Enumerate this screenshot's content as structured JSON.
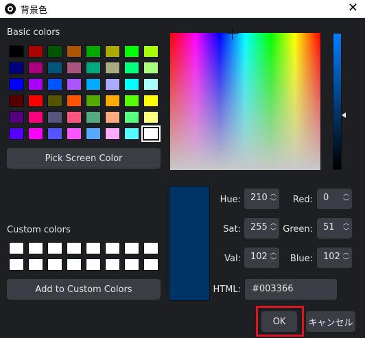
{
  "window": {
    "title": "背景色",
    "close_label": "✕"
  },
  "basic_colors": {
    "label": "Basic colors",
    "swatches": [
      "#000000",
      "#aa0000",
      "#005500",
      "#aa5500",
      "#00aa00",
      "#aaaa00",
      "#00ff00",
      "#aaff00",
      "#00007f",
      "#aa007f",
      "#00557f",
      "#aa557f",
      "#00aa7f",
      "#aaaa7f",
      "#00ff7f",
      "#aaff7f",
      "#0000ff",
      "#aa00ff",
      "#0055ff",
      "#aa55ff",
      "#00aaff",
      "#aaaaff",
      "#00ffff",
      "#aaffff",
      "#550000",
      "#ff0000",
      "#555500",
      "#ff5500",
      "#55aa00",
      "#ffaa00",
      "#55ff00",
      "#ffff00",
      "#55007f",
      "#ff007f",
      "#55557f",
      "#ff557f",
      "#55aa7f",
      "#ffaa7f",
      "#55ff7f",
      "#ffff7f",
      "#5500ff",
      "#ff00ff",
      "#5555ff",
      "#ff55ff",
      "#55aaff",
      "#ffaaff",
      "#55ffff",
      "#ffffff"
    ],
    "selected_index": 47
  },
  "pick_screen_color_label": "Pick Screen Color",
  "custom_colors": {
    "label": "Custom colors",
    "swatches": [
      "#ffffff",
      "#ffffff",
      "#ffffff",
      "#ffffff",
      "#ffffff",
      "#ffffff",
      "#ffffff",
      "#ffffff",
      "#ffffff",
      "#ffffff",
      "#ffffff",
      "#ffffff",
      "#ffffff",
      "#ffffff",
      "#ffffff",
      "#ffffff"
    ]
  },
  "add_custom_label": "Add to Custom Colors",
  "current_color": "#003366",
  "fields": {
    "hue": {
      "label": "Hue:",
      "value": "210"
    },
    "sat": {
      "label": "Sat:",
      "value": "255"
    },
    "val": {
      "label": "Val:",
      "value": "102"
    },
    "red": {
      "label": "Red:",
      "value": "0"
    },
    "green": {
      "label": "Green:",
      "value": "51"
    },
    "blue": {
      "label": "Blue:",
      "value": "102"
    },
    "html": {
      "label": "HTML:",
      "value": "#003366"
    }
  },
  "buttons": {
    "ok": "OK",
    "cancel": "キャンセル"
  },
  "icons": {
    "app": "obs-logo-icon",
    "close": "close-icon",
    "spin_up": "chevron-up-icon",
    "spin_down": "chevron-down-icon"
  },
  "highlight_color": "#e0141e"
}
